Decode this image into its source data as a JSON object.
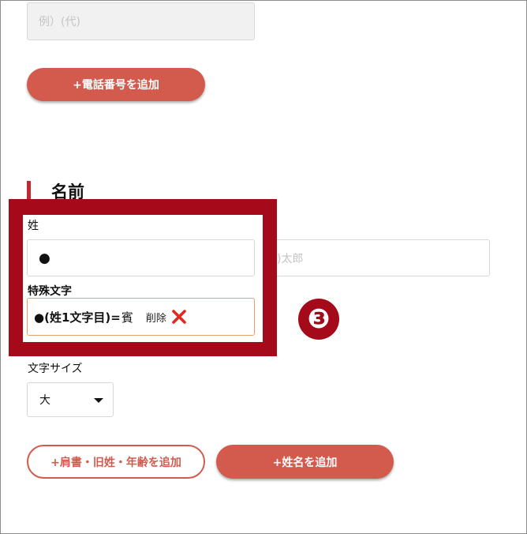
{
  "phone": {
    "placeholder": "例）(代)",
    "add_button": "+電話番号を追加"
  },
  "name_section": {
    "title": "名前",
    "last_name_label": "姓",
    "last_name_value": "●",
    "first_name_placeholder": "例)太郎",
    "special_char_label": "特殊文字",
    "special_char_value": "●(姓1文字目)=",
    "special_char_kanji": "賓",
    "delete_label": "削除",
    "step_number": "❸"
  },
  "font_size": {
    "label": "文字サイズ",
    "selected": "大"
  },
  "buttons": {
    "add_title": "+肩書・旧姓・年齢を追加",
    "add_name": "+姓名を追加"
  },
  "colors": {
    "accent": "#d25b4e",
    "highlight": "#a40a1a",
    "delete_x": "#e0281e"
  },
  "icons": [
    "close-x-icon",
    "chevron-down-icon"
  ]
}
